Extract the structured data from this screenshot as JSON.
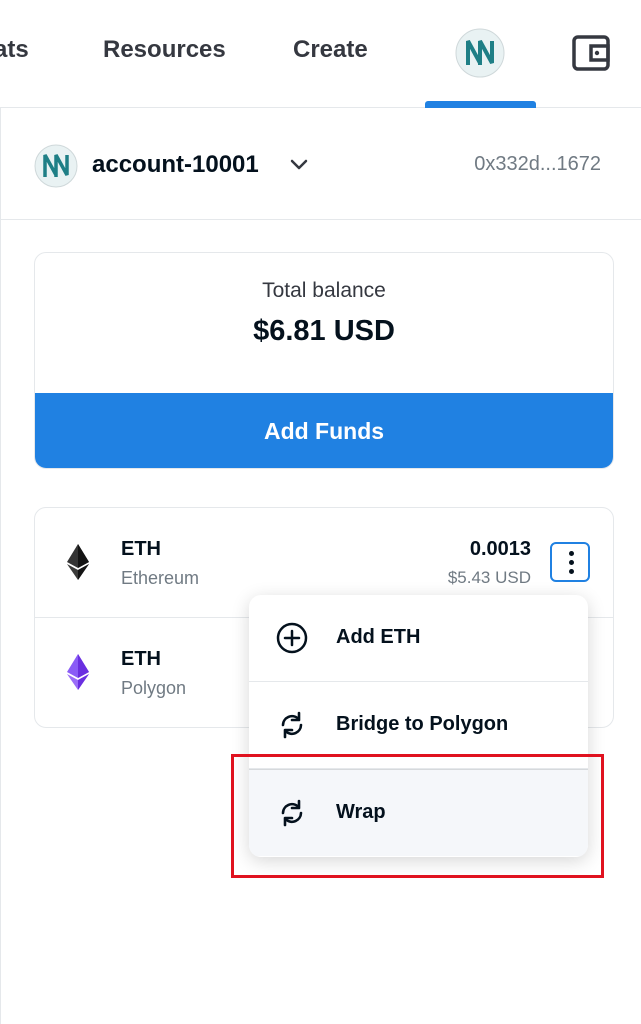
{
  "nav": {
    "items": [
      {
        "label": "ats"
      },
      {
        "label": "Resources"
      },
      {
        "label": "Create"
      }
    ],
    "accent_color": "#2081e2"
  },
  "account": {
    "name": "account-10001",
    "address": "0x332d...1672"
  },
  "balance": {
    "label": "Total balance",
    "value": "$6.81 USD",
    "add_funds_label": "Add Funds"
  },
  "tokens": [
    {
      "symbol": "ETH",
      "network": "Ethereum",
      "amount": "0.0013",
      "usd": "$5.43 USD",
      "icon": "ethereum-icon"
    },
    {
      "symbol": "ETH",
      "network": "Polygon",
      "amount": "",
      "usd": "",
      "icon": "polygon-eth-icon"
    }
  ],
  "menu": {
    "items": [
      {
        "label": "Add ETH",
        "icon": "plus-circle-icon"
      },
      {
        "label": "Bridge to Polygon",
        "icon": "refresh-icon"
      },
      {
        "label": "Wrap",
        "icon": "refresh-icon"
      }
    ]
  },
  "highlight_color": "#e0121f"
}
